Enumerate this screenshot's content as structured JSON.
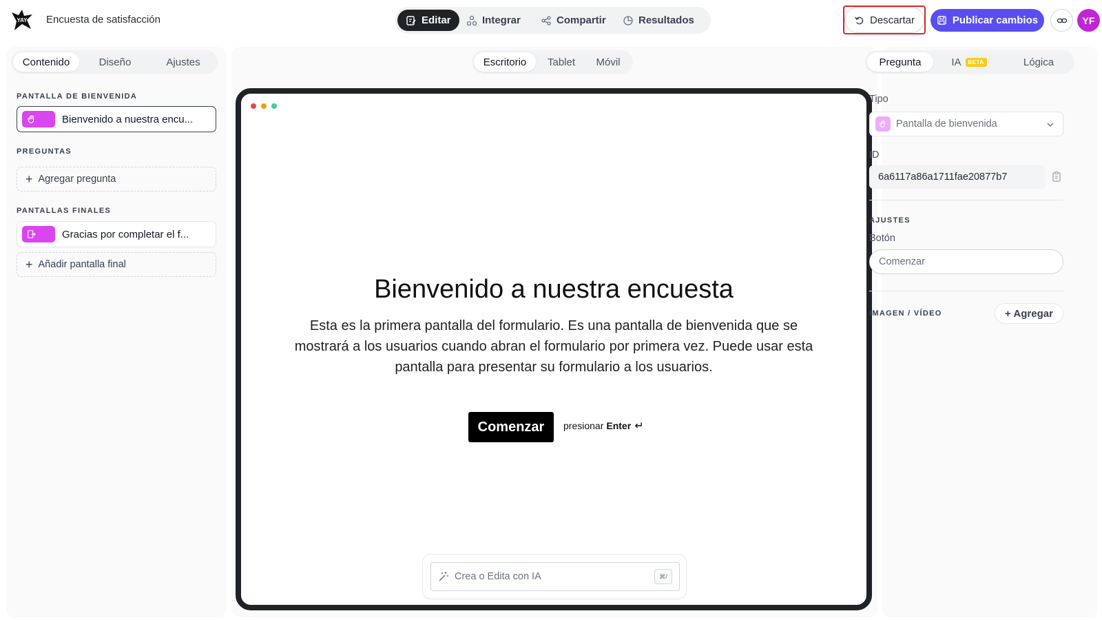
{
  "app": {
    "logo_text": "YAY",
    "form_title": "Encuesta de satisfacción"
  },
  "modes": {
    "edit": "Editar",
    "integrate": "Integrar",
    "share": "Compartir",
    "results": "Resultados"
  },
  "actions": {
    "discard": "Descartar",
    "publish": "Publicar cambios",
    "avatar_initials": "YF"
  },
  "left": {
    "tabs": [
      "Contenido",
      "Diseño",
      "Ajustes"
    ],
    "welcome_section": "PANTALLA DE BIENVENIDA",
    "welcome_item": "Bienvenido a nuestra encu...",
    "questions_section": "PREGUNTAS",
    "add_question": "Agregar pregunta",
    "endings_section": "PANTALLAS FINALES",
    "ending_item": "Gracias por completar el f...",
    "add_ending": "Añadir pantalla final"
  },
  "center": {
    "devices": [
      "Escritorio",
      "Tablet",
      "Móvil"
    ],
    "welcome_title": "Bienvenido a nuestra encuesta",
    "welcome_description": "Esta es la primera pantalla del formulario. Es una pantalla de bienvenida que se mostrará a los usuarios cuando abran el formulario por primera vez. Puede usar esta pantalla para presentar su formulario a los usuarios.",
    "start_button": "Comenzar",
    "press_hint_prefix": "presionar",
    "press_hint_key": "Enter",
    "ai_placeholder": "Crea o Edita con IA",
    "ai_shortcut": "⌘/"
  },
  "right": {
    "tabs": [
      "Pregunta",
      "IA",
      "Lógica"
    ],
    "beta_badge": "BETA",
    "type_label": "Tipo",
    "type_value": "Pantalla de bienvenida",
    "id_label": "ID",
    "id_value": "6a6117a86a1711fae20877b7",
    "settings_section": "AJUSTES",
    "button_label": "Botón",
    "button_placeholder": "Comenzar",
    "media_section": "IMAGEN / VÍDEO",
    "media_add": "+ Agregar"
  },
  "colors": {
    "brand_accent": "#5b4ef0",
    "chip_pink": "#d946ef",
    "avatar": "#c026d3",
    "highlight": "#dc2626",
    "mac_red": "#ef4444",
    "mac_yellow": "#f59e0b",
    "mac_green": "#34d399"
  }
}
